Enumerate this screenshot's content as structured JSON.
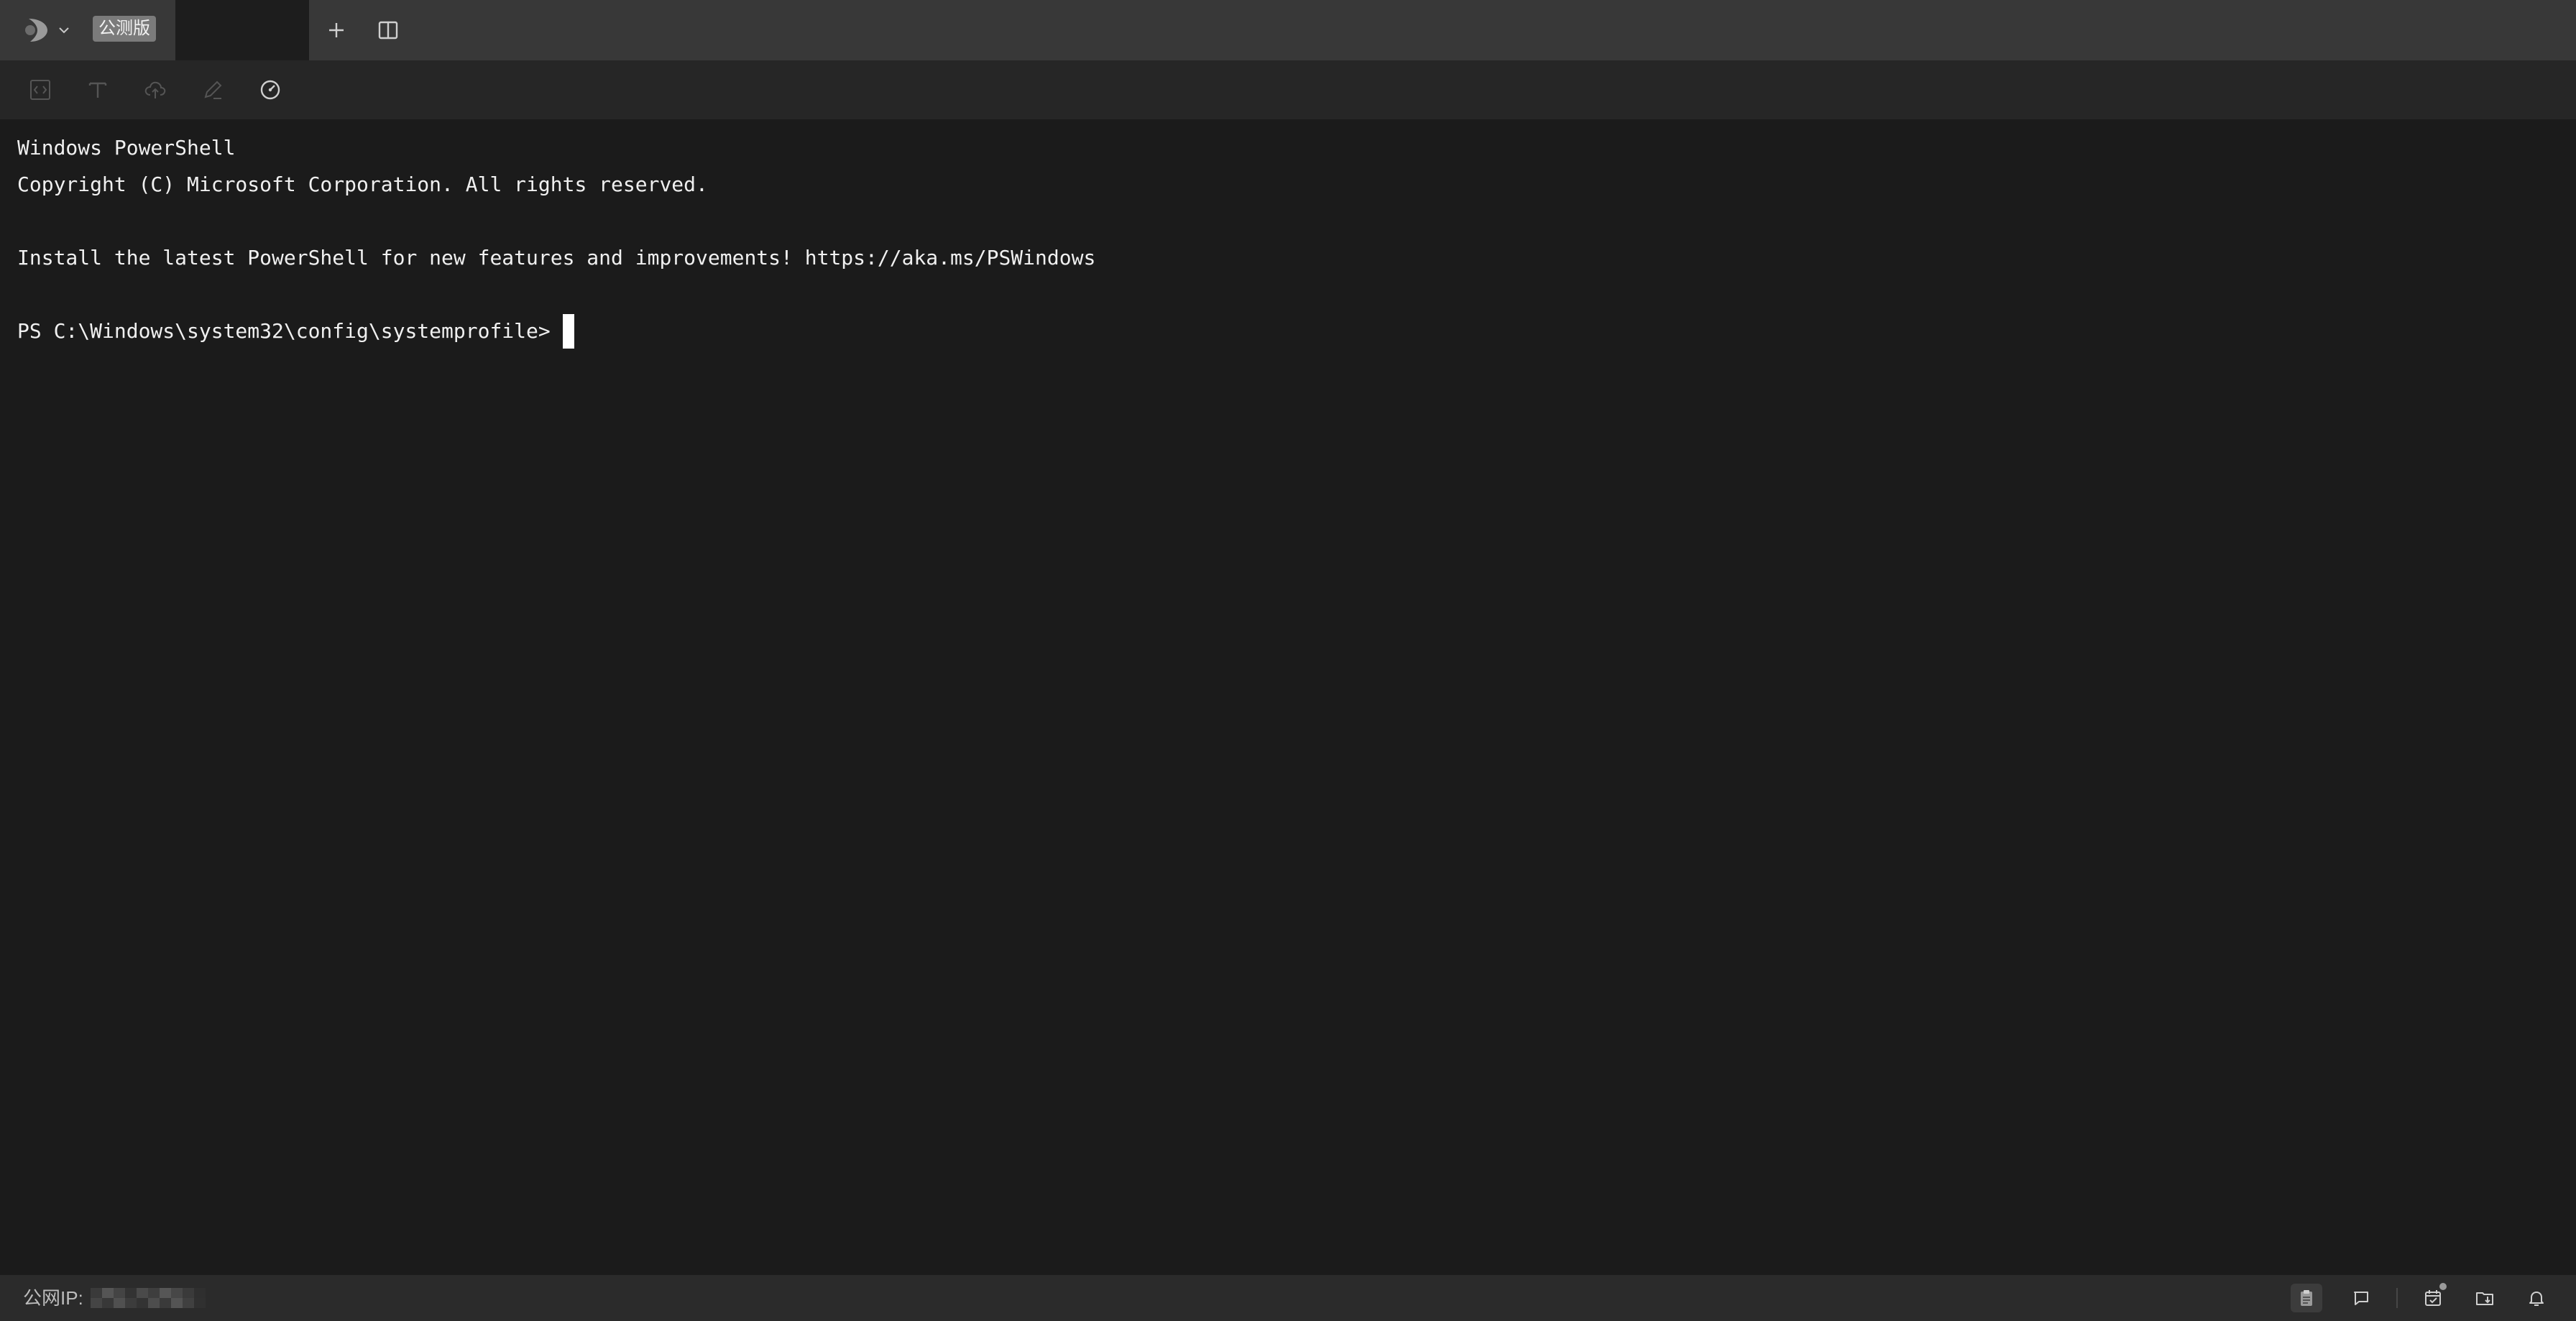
{
  "titlebar": {
    "badge": "公测版",
    "icons": [
      "app-logo",
      "chevron-down-icon",
      "plus-icon",
      "split-view-icon"
    ]
  },
  "toolbar": {
    "icons": [
      "code-block-icon",
      "text-format-icon",
      "cloud-upload-icon",
      "pen-icon",
      "gauge-icon"
    ]
  },
  "terminal": {
    "lines": [
      "Windows PowerShell",
      "Copyright (C) Microsoft Corporation. All rights reserved.",
      "",
      "Install the latest PowerShell for new features and improvements! https://aka.ms/PSWindows",
      "",
      "PS C:\\Windows\\system32\\config\\systemprofile> "
    ]
  },
  "statusbar": {
    "ip_label": "公网IP:",
    "icons": [
      "clipboard-icon",
      "chat-icon",
      "calendar-check-icon",
      "folder-download-icon",
      "bell-icon"
    ]
  },
  "colors": {
    "titlebar_bg": "#383838",
    "toolbar_bg": "#262626",
    "terminal_bg": "#1b1b1b",
    "terminal_fg": "#f0f0f0",
    "statusbar_bg": "#2b2b2b",
    "badge_bg": "#7b7b7b"
  }
}
